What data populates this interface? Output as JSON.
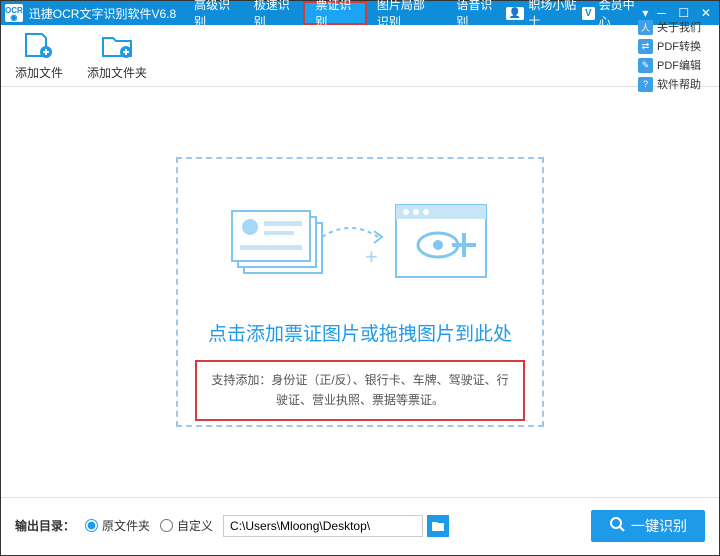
{
  "app": {
    "title": "迅捷OCR文字识别软件V6.8",
    "logo_text": "OCR"
  },
  "tabs": [
    {
      "label": "高级识别"
    },
    {
      "label": "极速识别"
    },
    {
      "label": "票证识别"
    },
    {
      "label": "图片局部识别"
    },
    {
      "label": "语音识别"
    }
  ],
  "header_right": {
    "help_label": "职场小贴士",
    "vip_label": "会员中心",
    "v_badge": "V",
    "user_icon": "👤"
  },
  "toolbar": {
    "add_file": "添加文件",
    "add_folder": "添加文件夹"
  },
  "side_buttons": {
    "about": "关于我们",
    "pdf_convert": "PDF转换",
    "pdf_edit": "PDF编辑",
    "soft_help": "软件帮助"
  },
  "dropzone": {
    "headline": "点击添加票证图片或拖拽图片到此处",
    "support": "支持添加：身份证（正/反）、银行卡、车牌、驾驶证、行驶证、营业执照、票据等票证。"
  },
  "bottom": {
    "out_label": "输出目录：",
    "opt_src": "原文件夹",
    "opt_custom": "自定义",
    "path": "C:\\Users\\Mloong\\Desktop\\",
    "run": "一键识别"
  },
  "colors": {
    "primary": "#1e9be8",
    "highlight": "#d93b3b"
  }
}
